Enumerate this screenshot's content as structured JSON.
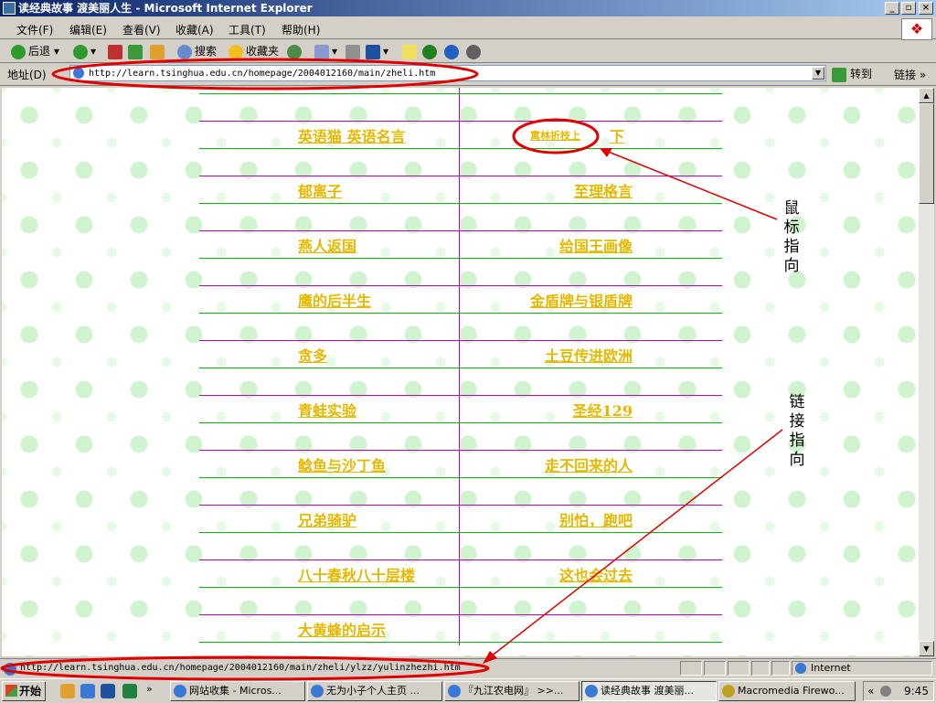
{
  "window": {
    "title": "读经典故事 渡美丽人生 - Microsoft Internet Explorer"
  },
  "menu": [
    "文件(F)",
    "编辑(E)",
    "查看(V)",
    "收藏(A)",
    "工具(T)",
    "帮助(H)"
  ],
  "toolbar": {
    "back": "后退",
    "search": "搜索",
    "favorites": "收藏夹"
  },
  "address": {
    "label": "地址(D)",
    "url": "http://learn.tsinghua.edu.cn/homepage/2004012160/main/zheli.htm",
    "go": "转到",
    "links": "链接"
  },
  "links_left": [
    "英语猫 英语名言",
    "郁离子",
    "燕人返国",
    "鹰的后半生",
    "贪多",
    "青蛙实验",
    "鲶鱼与沙丁鱼",
    "兄弟骑驴",
    "八十春秋八十层楼",
    "大黄蜂的启示"
  ],
  "links_right": [
    {
      "small": "寓林折枝上",
      "big": "下"
    },
    {
      "big": "至理格言"
    },
    {
      "big": "给国王画像"
    },
    {
      "big": "金盾牌与银盾牌"
    },
    {
      "big": "土豆传进欧洲"
    },
    {
      "big": "圣经129"
    },
    {
      "big": "走不回来的人"
    },
    {
      "big": "别怕，跑吧"
    },
    {
      "big": "这也会过去"
    }
  ],
  "annotations": {
    "mouse": "鼠标指向",
    "link": "链接指向"
  },
  "annotation_color": "#e00000",
  "status": {
    "url": "http://learn.tsinghua.edu.cn/homepage/2004012160/main/zheli/ylzz/yulinzhezhi.htm",
    "zone": "Internet"
  },
  "taskbar": {
    "start": "开始",
    "tasks": [
      "网站收集 - Micros...",
      "无为小子个人主页 ...",
      "『九江农电网』 >>...",
      "读经典故事 渡美丽...",
      "Macromedia Firewo..."
    ],
    "clock": "9:45"
  }
}
